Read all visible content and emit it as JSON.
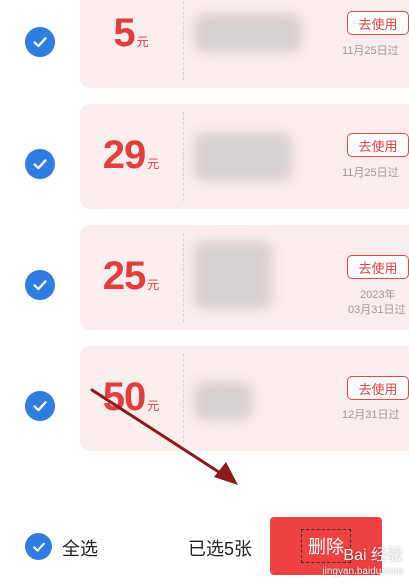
{
  "coupons": [
    {
      "amount": "5",
      "unit": "元",
      "use_label": "去使用",
      "expiry_line1": "11月25日过",
      "expiry_line2": ""
    },
    {
      "amount": "29",
      "unit": "元",
      "use_label": "去使用",
      "expiry_line1": "11月25日过",
      "expiry_line2": ""
    },
    {
      "amount": "25",
      "unit": "元",
      "use_label": "去使用",
      "expiry_line1": "2023年",
      "expiry_line2": "03月31日过"
    },
    {
      "amount": "50",
      "unit": "元",
      "use_label": "去使用",
      "expiry_line1": "12月31日过",
      "expiry_line2": ""
    }
  ],
  "footer": {
    "select_all_label": "全选",
    "selected_count_text": "已选5张",
    "delete_label": "删除"
  },
  "watermark": {
    "main": "Bai 经验",
    "sub": "jingyan.baidu.com"
  },
  "colors": {
    "accent_blue": "#2f7de1",
    "accent_red": "#ee4141",
    "coupon_bg": "#fdeeee"
  }
}
